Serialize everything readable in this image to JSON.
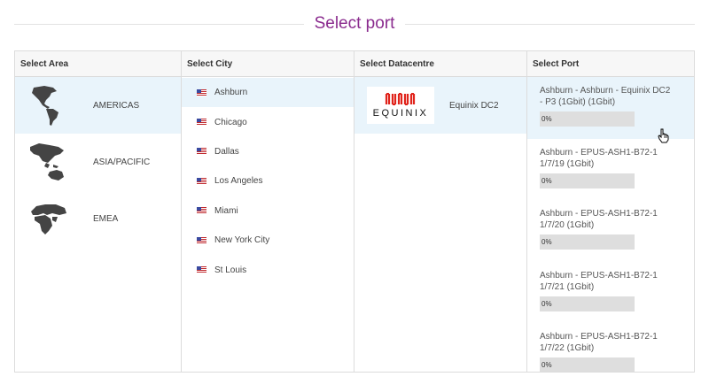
{
  "page": {
    "title": "Select port"
  },
  "columns": {
    "area": "Select Area",
    "city": "Select City",
    "datacentre": "Select Datacentre",
    "port": "Select Port"
  },
  "areas": [
    {
      "label": "AMERICAS",
      "icon": "americas-map-icon",
      "selected": true
    },
    {
      "label": "ASIA/PACIFIC",
      "icon": "asia-pacific-map-icon",
      "selected": false
    },
    {
      "label": "EMEA",
      "icon": "emea-map-icon",
      "selected": false
    }
  ],
  "cities": [
    {
      "label": "Ashburn",
      "icon": "us-flag-icon",
      "selected": true
    },
    {
      "label": "Chicago",
      "icon": "us-flag-icon"
    },
    {
      "label": "Dallas",
      "icon": "us-flag-icon"
    },
    {
      "label": "Los Angeles",
      "icon": "us-flag-icon"
    },
    {
      "label": "Miami",
      "icon": "us-flag-icon"
    },
    {
      "label": "New York City",
      "icon": "us-flag-icon"
    },
    {
      "label": "St Louis",
      "icon": "us-flag-icon"
    }
  ],
  "datacentres": [
    {
      "logo_text": "EQUINIX",
      "name": "Equinix DC2",
      "selected": true
    }
  ],
  "ports": [
    {
      "name": "Ashburn - Ashburn - Equinix DC2 - P3 (1Gbit) (1Gbit)",
      "usage": "0%",
      "selected": true
    },
    {
      "name": "Ashburn - EPUS-ASH1-B72-1 1/7/19 (1Gbit)",
      "usage": "0%"
    },
    {
      "name": "Ashburn - EPUS-ASH1-B72-1 1/7/20 (1Gbit)",
      "usage": "0%"
    },
    {
      "name": "Ashburn - EPUS-ASH1-B72-1 1/7/21 (1Gbit)",
      "usage": "0%"
    },
    {
      "name": "Ashburn - EPUS-ASH1-B72-1 1/7/22 (1Gbit)",
      "usage": "0%"
    }
  ],
  "colors": {
    "accent": "#8a2b8e",
    "selected_bg": "#e9f4fb",
    "equinix_red": "#e0231b"
  }
}
